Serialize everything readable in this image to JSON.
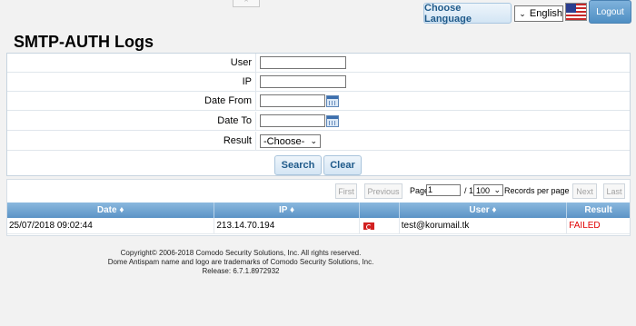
{
  "header": {
    "collapse_glyph": "^",
    "choose_language_label": "Choose Language",
    "language_selected": "English",
    "logout_label": "Logout"
  },
  "page": {
    "title": "SMTP-AUTH Logs"
  },
  "form": {
    "user_label": "User",
    "ip_label": "IP",
    "date_from_label": "Date From",
    "date_to_label": "Date To",
    "result_label": "Result",
    "result_selected": "-Choose-",
    "search_label": "Search",
    "clear_label": "Clear"
  },
  "pager": {
    "first": "First",
    "previous": "Previous",
    "page_label": "Page",
    "page_value": "1",
    "of_label": "/ 1",
    "records_value": "100",
    "records_label": "Records per page",
    "next": "Next",
    "last": "Last"
  },
  "table": {
    "columns": [
      "Date ♦",
      "IP ♦",
      "",
      "User ♦",
      "Result"
    ],
    "rows": [
      {
        "date": "25/07/2018 09:02:44",
        "ip": "213.14.70.194",
        "flag": "turkey-flag-icon",
        "user": "test@korumail.tk",
        "result": "FAILED"
      }
    ]
  },
  "footer": {
    "line1": "Copyright© 2006-2018 Comodo Security Solutions, Inc. All rights reserved.",
    "line2": "Dome Antispam name and logo are trademarks of Comodo Security Solutions, Inc.",
    "line3": "Release: 6.7.1.8972932"
  },
  "colors": {
    "accent": "#5b93c6",
    "failed": "#e00000",
    "title": "#000000"
  }
}
